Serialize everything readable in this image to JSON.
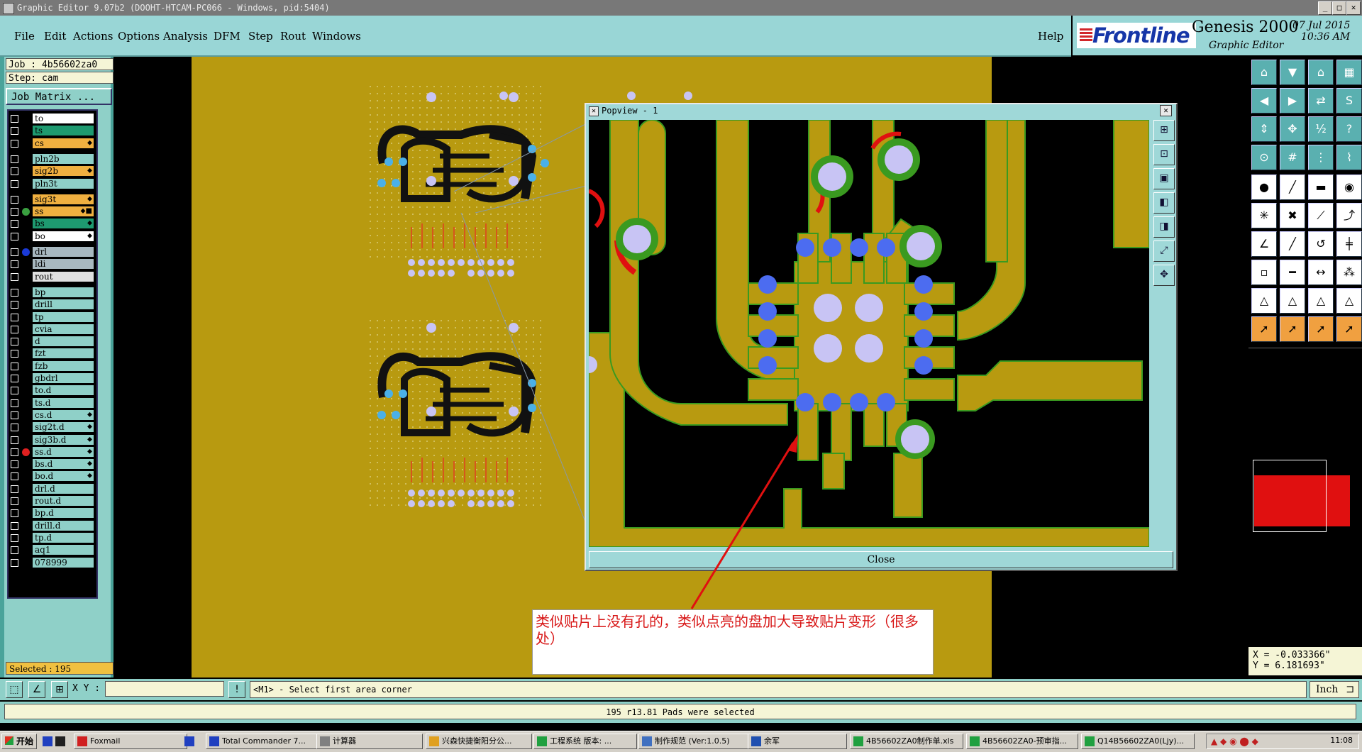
{
  "window": {
    "title": "Graphic Editor 9.07b2 (DOOHT-HTCAM-PC066 - Windows, pid:5404)"
  },
  "menu": {
    "items": [
      "File",
      "Edit",
      "Actions",
      "Options",
      "Analysis",
      "DFM",
      "Step",
      "Rout",
      "Windows"
    ],
    "help": "Help"
  },
  "brand": {
    "logo": "Frontline",
    "product": "Genesis 2000",
    "subtitle": "Graphic Editor",
    "date": "07 Jul 2015",
    "time": "10:36 AM",
    "logo_color": "#1636a8",
    "logo_bar_color": "#d2262a"
  },
  "job": {
    "job_label": "Job : 4b56602za0",
    "step_label": "Step: cam",
    "matrix_button": "Job Matrix ..."
  },
  "layers": [
    {
      "name": "to",
      "color": "#ffffff",
      "dot": "",
      "mark": ""
    },
    {
      "name": "ts",
      "color": "#1e9a70",
      "dot": "",
      "mark": ""
    },
    {
      "name": "cs",
      "color": "#f0b040",
      "dot": "",
      "mark": "⬥"
    },
    {
      "name": "pln2b",
      "color": "#8fd0c8",
      "dot": "",
      "mark": ""
    },
    {
      "name": "sig2b",
      "color": "#f0b040",
      "dot": "",
      "mark": "⬥"
    },
    {
      "name": "pln3t",
      "color": "#8fd0c8",
      "dot": "",
      "mark": ""
    },
    {
      "name": "sig3t",
      "color": "#f0b040",
      "dot": "",
      "mark": "⬥"
    },
    {
      "name": "ss",
      "color": "#f0b040",
      "dot": "#3aa040",
      "mark": "⬥■"
    },
    {
      "name": "bs",
      "color": "#1e9a70",
      "dot": "",
      "mark": "⬥"
    },
    {
      "name": "bo",
      "color": "#ffffff",
      "dot": "",
      "mark": "⬥"
    },
    {
      "name": "drl",
      "color": "#a8b8c0",
      "dot": "#1a3ad8",
      "mark": ""
    },
    {
      "name": "ldi",
      "color": "#a8b8c0",
      "dot": "",
      "mark": ""
    },
    {
      "name": "rout",
      "color": "#e0e0e0",
      "dot": "",
      "mark": ""
    },
    {
      "name": "bp",
      "color": "#8fd0c8",
      "dot": "",
      "mark": ""
    },
    {
      "name": "drill",
      "color": "#8fd0c8",
      "dot": "",
      "mark": ""
    },
    {
      "name": "tp",
      "color": "#8fd0c8",
      "dot": "",
      "mark": ""
    },
    {
      "name": "cvia",
      "color": "#8fd0c8",
      "dot": "",
      "mark": ""
    },
    {
      "name": "d",
      "color": "#8fd0c8",
      "dot": "",
      "mark": ""
    },
    {
      "name": "fzt",
      "color": "#8fd0c8",
      "dot": "",
      "mark": ""
    },
    {
      "name": "fzb",
      "color": "#8fd0c8",
      "dot": "",
      "mark": ""
    },
    {
      "name": "gbdrl",
      "color": "#8fd0c8",
      "dot": "",
      "mark": ""
    },
    {
      "name": "to.d",
      "color": "#8fd0c8",
      "dot": "",
      "mark": ""
    },
    {
      "name": "ts.d",
      "color": "#8fd0c8",
      "dot": "",
      "mark": ""
    },
    {
      "name": "cs.d",
      "color": "#8fd0c8",
      "dot": "",
      "mark": "⬥"
    },
    {
      "name": "sig2t.d",
      "color": "#8fd0c8",
      "dot": "",
      "mark": "⬥"
    },
    {
      "name": "sig3b.d",
      "color": "#8fd0c8",
      "dot": "",
      "mark": "⬥"
    },
    {
      "name": "ss.d",
      "color": "#8fd0c8",
      "dot": "#e02020",
      "mark": "⬥"
    },
    {
      "name": "bs.d",
      "color": "#8fd0c8",
      "dot": "",
      "mark": "⬥"
    },
    {
      "name": "bo.d",
      "color": "#8fd0c8",
      "dot": "",
      "mark": "⬥"
    },
    {
      "name": "drl.d",
      "color": "#8fd0c8",
      "dot": "",
      "mark": ""
    },
    {
      "name": "rout.d",
      "color": "#8fd0c8",
      "dot": "",
      "mark": ""
    },
    {
      "name": "bp.d",
      "color": "#8fd0c8",
      "dot": "",
      "mark": ""
    },
    {
      "name": "drill.d",
      "color": "#8fd0c8",
      "dot": "",
      "mark": ""
    },
    {
      "name": "tp.d",
      "color": "#8fd0c8",
      "dot": "",
      "mark": ""
    },
    {
      "name": "aq1",
      "color": "#8fd0c8",
      "dot": "",
      "mark": ""
    },
    {
      "name": "078999",
      "color": "#8fd0c8",
      "dot": "",
      "mark": ""
    }
  ],
  "selection": {
    "label": "Selected : 195"
  },
  "popview": {
    "title": "Popview - 1",
    "close_label": "Close"
  },
  "annotation": {
    "text": "类似贴片上没有孔的，类似点亮的盘加大导致贴片变形（很多处）"
  },
  "coords": {
    "x": "X = -0.033366\"",
    "y": "Y = 6.181693\""
  },
  "command": {
    "xy_label": "X Y :",
    "xy_value": "",
    "prompt": "<M1> - Select first area corner",
    "unit": "Inch"
  },
  "status": {
    "message": "195 r13.81 Pads were selected"
  },
  "taskbar": {
    "start": "开始",
    "items": [
      "Foxmail",
      "Total Commander 7...",
      "计算器",
      "兴森快捷衡阳分公...",
      "工程系统  版本: ...",
      "制作规范 (Ver:1.0.5)",
      "余军",
      "4B56602ZA0制作单.xls",
      "4B56602ZA0-预审指...",
      "Q14B56602ZA0(Ljy)..."
    ],
    "clock": "11:08"
  },
  "colors": {
    "board": "#b89a10",
    "teal_panel": "#8fd0c8",
    "copper": "#b89a10",
    "pad_blue": "#4c6cf0",
    "pad_lilac": "#c8c4f4",
    "ring_green": "#3a9a20",
    "ring_red": "#e01010"
  }
}
